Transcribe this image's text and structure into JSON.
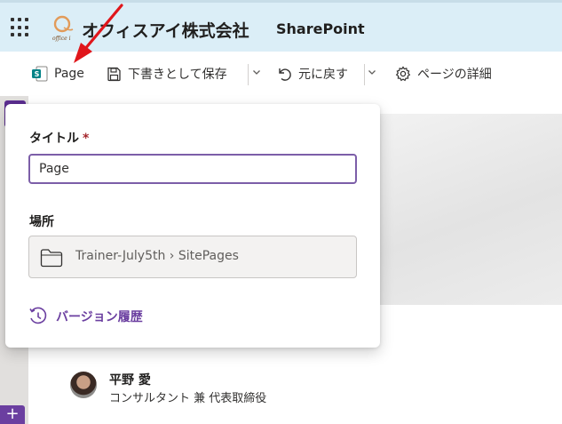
{
  "suite": {
    "org_name": "オフィスアイ株式会社",
    "app_name": "SharePoint",
    "logo_text": "office i"
  },
  "commands": {
    "page": "Page",
    "save_draft": "下書きとして保存",
    "undo": "元に戻す",
    "page_details": "ページの詳細"
  },
  "panel": {
    "title_label": "タイトル",
    "required_mark": "*",
    "title_value": "Page",
    "location_label": "場所",
    "location_path": "Trainer-July5th › SitePages",
    "version_history": "バージョン履歴"
  },
  "author": {
    "name": "平野 愛",
    "role": "コンサルタント 兼 代表取締役"
  },
  "sidebar": {
    "add_label": "+"
  },
  "colors": {
    "accent": "#6b3fa0",
    "suite_bg": "#dbeef7",
    "annotation_arrow": "#e0161b"
  }
}
